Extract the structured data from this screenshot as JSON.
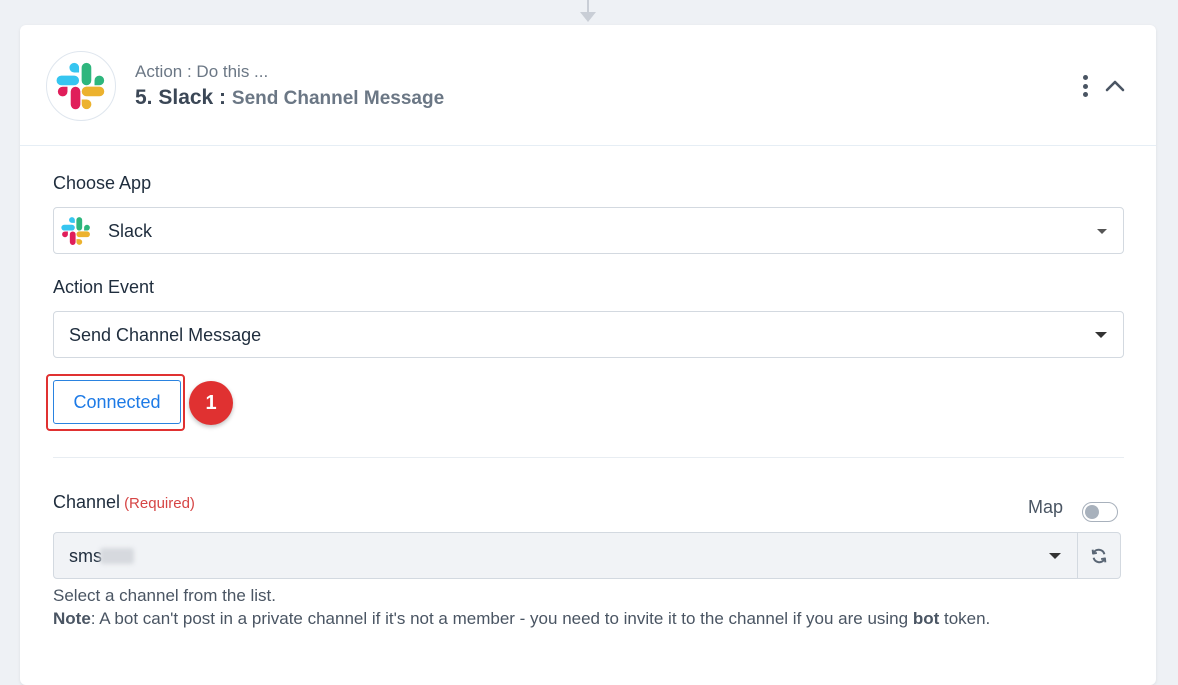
{
  "header": {
    "subtitle": "Action : Do this ...",
    "app_prefix": "5. Slack :",
    "event_title": "Send Channel Message"
  },
  "icons": {
    "app_logo": "slack-logo",
    "menu": "kebab-icon",
    "collapse": "chevron-up-icon",
    "refresh": "refresh-icon"
  },
  "choose_app": {
    "label": "Choose App",
    "value": "Slack"
  },
  "action_event": {
    "label": "Action Event",
    "value": "Send Channel Message"
  },
  "connection": {
    "button_label": "Connected",
    "step_badge": "1"
  },
  "channel": {
    "label": "Channel",
    "required": "(Required)",
    "map_label": "Map",
    "value": "sms",
    "help_text": "Select a channel from the list.",
    "note_label": "Note",
    "note_text_1": ": A bot can't post in a private channel if it's not a member - you need to invite it to the channel if you are using ",
    "note_bold": "bot",
    "note_text_2": " token."
  },
  "colors": {
    "accent": "#1d7ae6",
    "highlight": "#e03131",
    "required": "#d64545"
  }
}
